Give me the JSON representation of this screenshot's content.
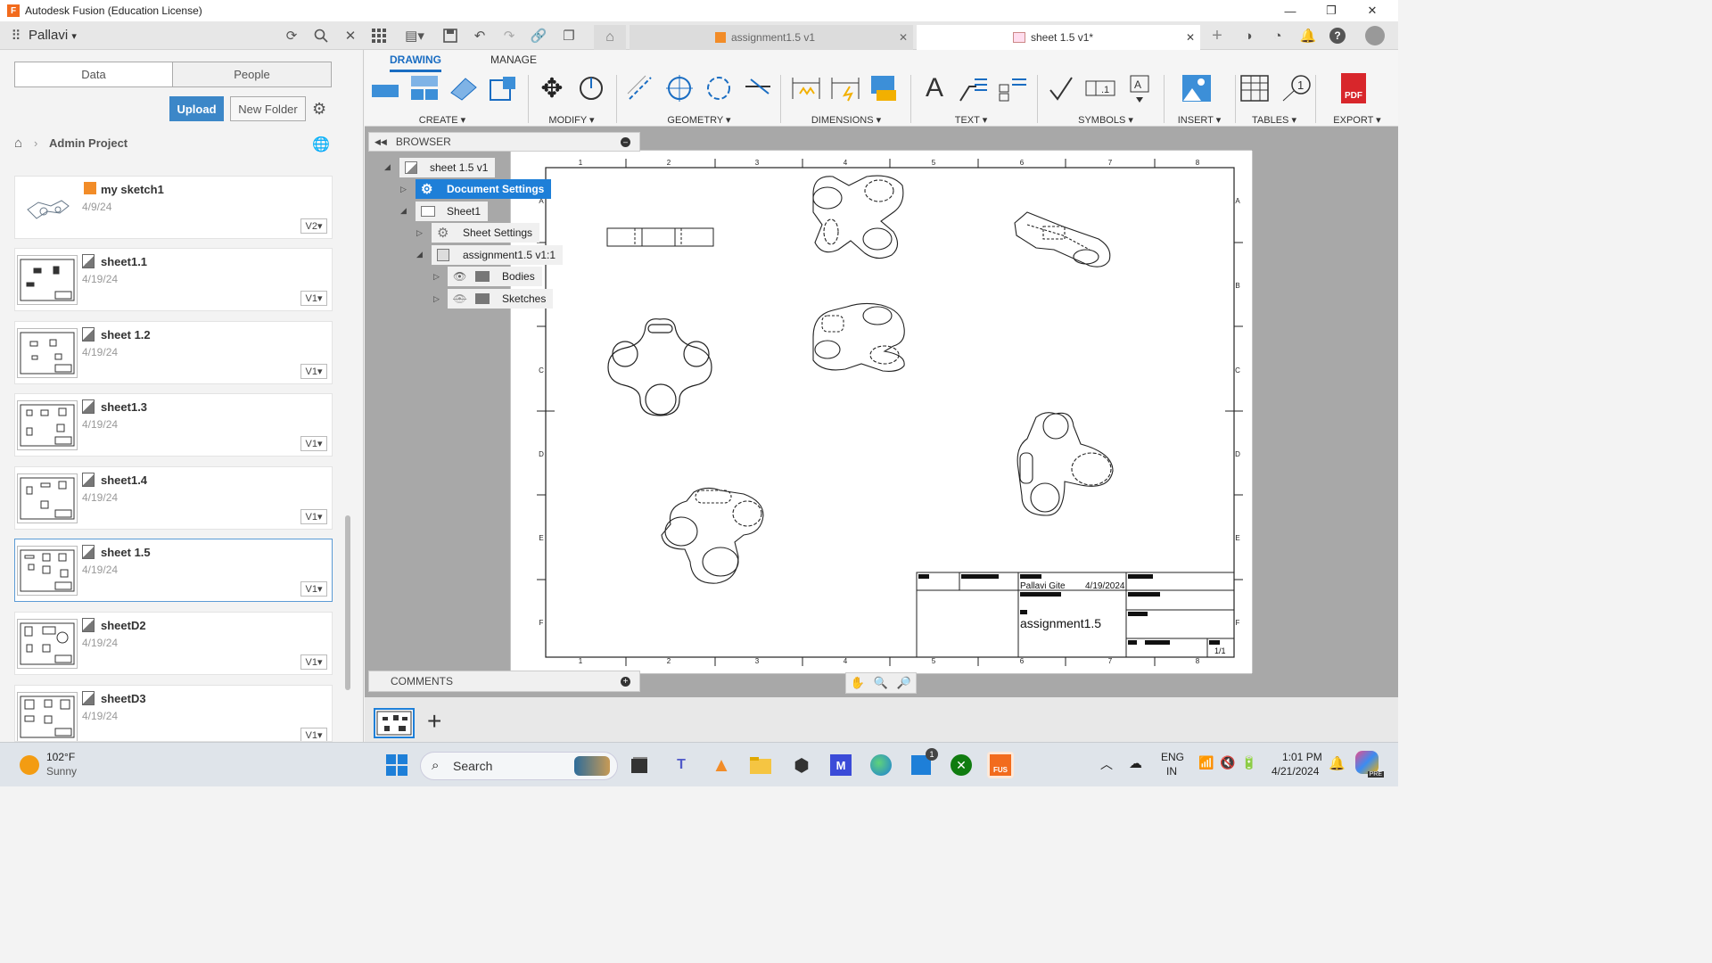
{
  "window": {
    "title": "Autodesk Fusion (Education License)",
    "app_letter": "F"
  },
  "appbar": {
    "user": "Pallavi",
    "tabs": [
      {
        "label": "assignment1.5 v1"
      },
      {
        "label": "sheet 1.5 v1*"
      }
    ]
  },
  "left_panel": {
    "segments": [
      "Data",
      "People"
    ],
    "upload_label": "Upload",
    "new_folder_label": "New Folder",
    "breadcrumb": "Admin Project",
    "files": [
      {
        "name": "my sketch1",
        "date": "4/9/24",
        "version": "V2"
      },
      {
        "name": "sheet1.1",
        "date": "4/19/24",
        "version": "V1"
      },
      {
        "name": "sheet 1.2",
        "date": "4/19/24",
        "version": "V1"
      },
      {
        "name": "sheet1.3",
        "date": "4/19/24",
        "version": "V1"
      },
      {
        "name": "sheet1.4",
        "date": "4/19/24",
        "version": "V1"
      },
      {
        "name": "sheet 1.5",
        "date": "4/19/24",
        "version": "V1"
      },
      {
        "name": "sheetD2",
        "date": "4/19/24",
        "version": "V1"
      },
      {
        "name": "sheetD3",
        "date": "4/19/24",
        "version": "V1"
      }
    ]
  },
  "toolbar": {
    "tabs": [
      "DRAWING",
      "MANAGE"
    ],
    "groups": [
      "CREATE",
      "MODIFY",
      "GEOMETRY",
      "DIMENSIONS",
      "TEXT",
      "SYMBOLS",
      "INSERT",
      "TABLES",
      "EXPORT"
    ],
    "pdf_label": "PDF"
  },
  "browser": {
    "title": "BROWSER",
    "root": "sheet 1.5 v1",
    "doc_settings": "Document Settings",
    "sheet": "Sheet1",
    "sheet_settings": "Sheet Settings",
    "assembly": "assignment1.5 v1:1",
    "bodies": "Bodies",
    "sketches": "Sketches"
  },
  "comments": {
    "title": "COMMENTS"
  },
  "drawing": {
    "col_labels": [
      "1",
      "2",
      "3",
      "4",
      "5",
      "6",
      "7",
      "8"
    ],
    "row_labels": [
      "A",
      "B",
      "C",
      "D",
      "E",
      "F"
    ],
    "title_block": {
      "author": "Pallavi Gite",
      "date": "4/19/2024",
      "title": "assignment1.5",
      "sheet": "1/1"
    }
  },
  "taskbar": {
    "weather_temp": "102°F",
    "weather_desc": "Sunny",
    "search_label": "Search",
    "lang1": "ENG",
    "lang2": "IN",
    "time": "1:01 PM",
    "date": "4/21/2024",
    "teams_badge": "1",
    "fusion_label": "FUS",
    "pre_badge": "PRE"
  }
}
